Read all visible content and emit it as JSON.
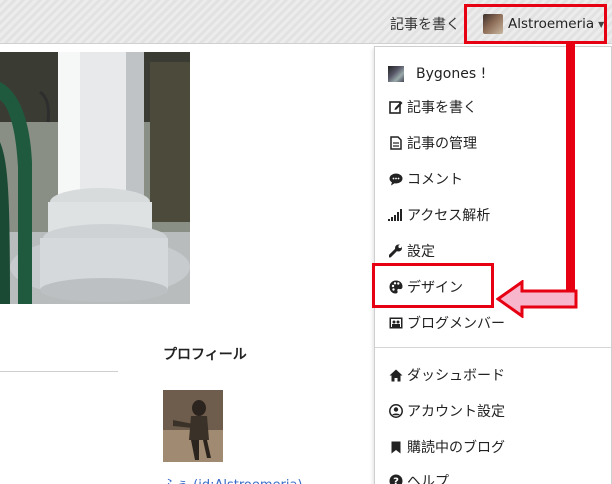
{
  "header": {
    "write_link": "記事を書く",
    "user_name": "Alstroemeria",
    "caret_icon": "caret-down-icon"
  },
  "main": {
    "profile_heading": "プロフィール",
    "profile_link": "ふぅ (id:Alstroemeria)"
  },
  "dropdown": {
    "items": [
      {
        "label": "Bygones !",
        "icon": "blog-thumbnail"
      },
      {
        "label": "記事を書く",
        "icon": "edit-icon"
      },
      {
        "label": "記事の管理",
        "icon": "document-icon"
      },
      {
        "label": "コメント",
        "icon": "comment-icon"
      },
      {
        "label": "アクセス解析",
        "icon": "bar-chart-icon"
      },
      {
        "label": "設定",
        "icon": "wrench-icon"
      },
      {
        "label": "デザイン",
        "icon": "palette-icon"
      },
      {
        "label": "ブログメンバー",
        "icon": "members-icon"
      },
      {
        "label": "ダッシュボード",
        "icon": "home-icon"
      },
      {
        "label": "アカウント設定",
        "icon": "user-icon"
      },
      {
        "label": "購読中のブログ",
        "icon": "bookmark-icon"
      },
      {
        "label": "ヘルプ",
        "icon": "help-icon"
      }
    ]
  },
  "colors": {
    "highlight": "#e60012",
    "arrow_fill": "#f7b6cc",
    "link": "#3a6cc7"
  }
}
